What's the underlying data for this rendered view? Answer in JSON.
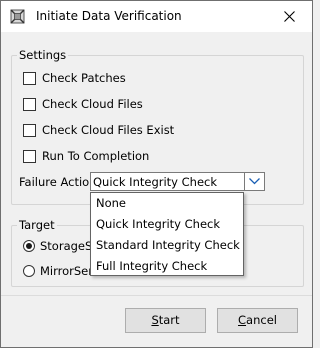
{
  "window": {
    "title": "Initiate Data Verification"
  },
  "settings": {
    "group_label": "Settings",
    "checkboxes": [
      {
        "label": "Check Patches",
        "checked": false
      },
      {
        "label": "Check Cloud Files",
        "checked": false
      },
      {
        "label": "Check Cloud Files Exist",
        "checked": false
      },
      {
        "label": "Run To Completion",
        "checked": false
      }
    ],
    "failure_action": {
      "label": "Failure Action",
      "selected": "Quick Integrity Check",
      "options": [
        "None",
        "Quick Integrity Check",
        "Standard Integrity Check",
        "Full Integrity Check"
      ]
    }
  },
  "target": {
    "group_label": "Target",
    "radios": [
      {
        "label": "StorageSe",
        "selected": true
      },
      {
        "label": "MirrorServ",
        "selected": false
      }
    ]
  },
  "buttons": {
    "start_prefix": "S",
    "start_rest": "tart",
    "cancel_prefix": "C",
    "cancel_rest": "ancel"
  }
}
